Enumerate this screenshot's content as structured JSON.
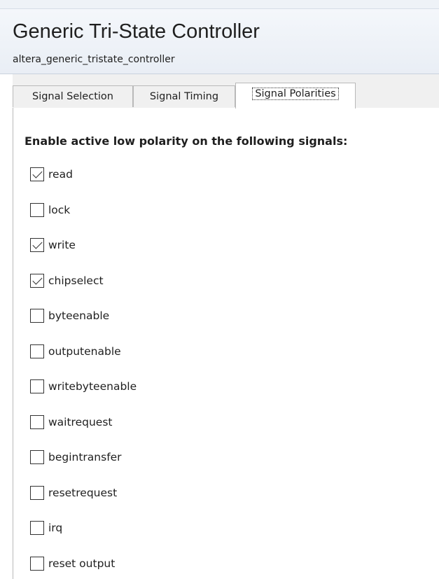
{
  "header": {
    "title": "Generic Tri-State Controller",
    "subtitle": "altera_generic_tristate_controller"
  },
  "tabs": [
    {
      "label": "Signal Selection",
      "active": false
    },
    {
      "label": "Signal Timing",
      "active": false
    },
    {
      "label": "Signal Polarities",
      "active": true
    }
  ],
  "polarities": {
    "heading": "Enable active low polarity on the following signals:",
    "signals": [
      {
        "label": "read",
        "checked": true
      },
      {
        "label": "lock",
        "checked": false
      },
      {
        "label": "write",
        "checked": true
      },
      {
        "label": "chipselect",
        "checked": true
      },
      {
        "label": "byteenable",
        "checked": false
      },
      {
        "label": "outputenable",
        "checked": false
      },
      {
        "label": "writebyteenable",
        "checked": false
      },
      {
        "label": "waitrequest",
        "checked": false
      },
      {
        "label": "begintransfer",
        "checked": false
      },
      {
        "label": "resetrequest",
        "checked": false
      },
      {
        "label": "irq",
        "checked": false
      },
      {
        "label": "reset output",
        "checked": false
      }
    ]
  }
}
